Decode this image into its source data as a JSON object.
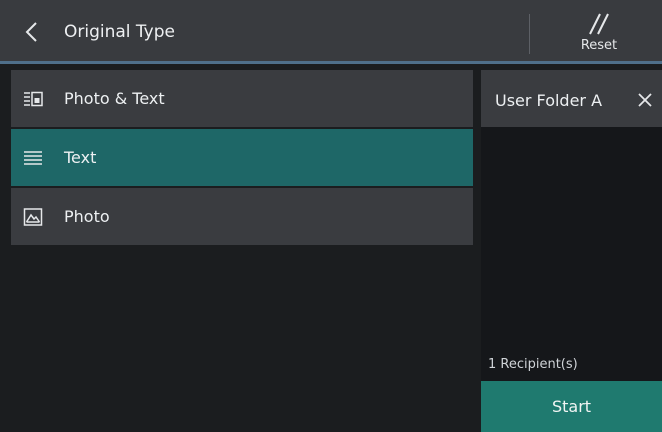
{
  "header": {
    "title": "Original Type",
    "reset_label": "Reset",
    "back_icon": "chevron-left-icon",
    "reset_icon": "reset-slashes-icon"
  },
  "options": [
    {
      "label": "Photo & Text",
      "icon": "photo-text-icon",
      "selected": false
    },
    {
      "label": "Text",
      "icon": "text-lines-icon",
      "selected": true
    },
    {
      "label": "Photo",
      "icon": "photo-icon",
      "selected": false
    }
  ],
  "recipients": {
    "folder_name": "User Folder A",
    "remove_icon": "close-icon",
    "count_text": "1 Recipient(s)"
  },
  "start_label": "Start",
  "colors": {
    "header_bg": "#393b3f",
    "item_bg": "#3a3c40",
    "selected_bg": "#1e6767",
    "start_bg": "#1f7a6f",
    "accent_line": "#4f6f8a",
    "background": "#1b1d1f"
  }
}
